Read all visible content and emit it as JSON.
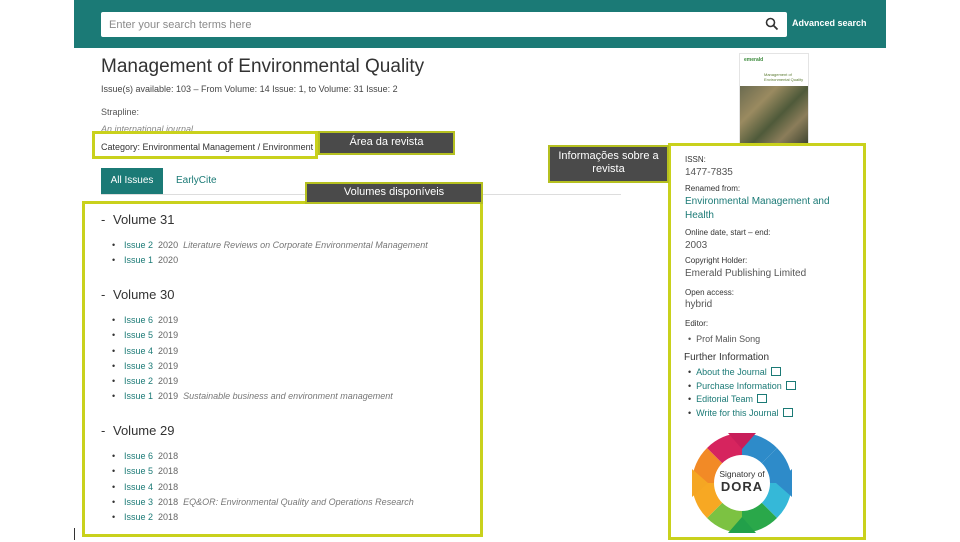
{
  "search": {
    "placeholder": "Enter your search terms here",
    "advanced_label": "Advanced search"
  },
  "journal": {
    "title": "Management of Environmental Quality",
    "issues_line": "Issue(s) available: 103 – From Volume: 14 Issue: 1, to Volume: 31 Issue: 2",
    "strapline_label": "Strapline:",
    "strapline_value": "An international journal",
    "category": "Category: Environmental Management / Environment"
  },
  "cover": {
    "logo": "emerald",
    "title": "Management of Environmental Quality"
  },
  "tabs": {
    "all": "All Issues",
    "early": "EarlyCite"
  },
  "volumes": [
    {
      "title": "Volume 31",
      "issues": [
        {
          "issue": "Issue 2",
          "year": "2020",
          "special": "Literature Reviews on Corporate Environmental Management"
        },
        {
          "issue": "Issue 1",
          "year": "2020",
          "special": ""
        }
      ]
    },
    {
      "title": "Volume 30",
      "issues": [
        {
          "issue": "Issue 6",
          "year": "2019",
          "special": ""
        },
        {
          "issue": "Issue 5",
          "year": "2019",
          "special": ""
        },
        {
          "issue": "Issue 4",
          "year": "2019",
          "special": ""
        },
        {
          "issue": "Issue 3",
          "year": "2019",
          "special": ""
        },
        {
          "issue": "Issue 2",
          "year": "2019",
          "special": ""
        },
        {
          "issue": "Issue 1",
          "year": "2019",
          "special": "Sustainable business and environment management"
        }
      ]
    },
    {
      "title": "Volume 29",
      "issues": [
        {
          "issue": "Issue 6",
          "year": "2018",
          "special": ""
        },
        {
          "issue": "Issue 5",
          "year": "2018",
          "special": ""
        },
        {
          "issue": "Issue 4",
          "year": "2018",
          "special": ""
        },
        {
          "issue": "Issue 3",
          "year": "2018",
          "special": "EQ&OR: Environmental Quality and Operations Research"
        },
        {
          "issue": "Issue 2",
          "year": "2018",
          "special": ""
        }
      ]
    }
  ],
  "info": {
    "issn_label": "ISSN:",
    "issn_value": "1477-7835",
    "renamed_label": "Renamed from:",
    "renamed_value": "Environmental Management and Health",
    "online_label": "Online date, start – end:",
    "online_value": "2003",
    "copyright_label": "Copyright Holder:",
    "copyright_value": "Emerald Publishing Limited",
    "open_label": "Open access:",
    "open_value": "hybrid",
    "editor_label": "Editor:",
    "editor_value": "Prof Malin Song",
    "further_title": "Further Information",
    "further_links": [
      "About the Journal",
      "Purchase Information",
      "Editorial Team",
      "Write for this Journal"
    ]
  },
  "dora": {
    "line1": "Signatory of",
    "line2": "DORA"
  },
  "annotations": {
    "area": "Área da revista",
    "volumes": "Volumes disponíveis",
    "info": "Informações sobre a revista"
  },
  "colors": {
    "brand": "#1b7a76",
    "highlight": "#c9d11c",
    "callout_bg": "#4a4a4a"
  }
}
